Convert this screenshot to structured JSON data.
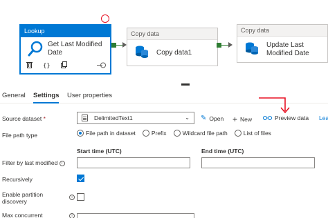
{
  "pipeline": {
    "lookup": {
      "header": "Lookup",
      "name": "Get Last Modified Date"
    },
    "copy1": {
      "header": "Copy data",
      "name": "Copy data1"
    },
    "copy2": {
      "header": "Copy data",
      "name": "Update Last Modified Date"
    }
  },
  "tabs": [
    {
      "label": "General"
    },
    {
      "label": "Settings"
    },
    {
      "label": "User properties"
    }
  ],
  "form": {
    "source_dataset": {
      "label": "Source dataset",
      "required_marker": "*",
      "value": "DelimitedText1"
    },
    "actions": {
      "open": "Open",
      "new": "New",
      "preview": "Preview data",
      "learn": "Lea"
    },
    "file_path_type": {
      "label": "File path type",
      "options": [
        "File path in dataset",
        "Prefix",
        "Wildcard file path",
        "List of files"
      ],
      "selected": "File path in dataset"
    },
    "start_time_label": "Start time (UTC)",
    "end_time_label": "End time (UTC)",
    "filter_label": "Filter by last modified",
    "recursively_label": "Recursively",
    "partition_label_line1": "Enable partition",
    "partition_label_line2": "discovery",
    "max_concurrent_label": "Max concurrent"
  },
  "colors": {
    "accent": "#0078d4",
    "success": "#2e7d32",
    "annotation": "#e81123"
  }
}
